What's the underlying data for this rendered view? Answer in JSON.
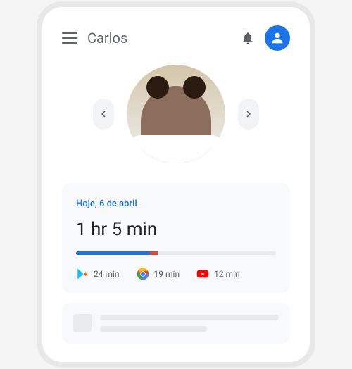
{
  "header": {
    "title": "Carlos"
  },
  "usage_card": {
    "date_label": "Hoje, 6 de abril",
    "total_time": "1 hr 5 min",
    "apps": [
      {
        "name": "play",
        "time": "24 min"
      },
      {
        "name": "chrome",
        "time": "19 min"
      },
      {
        "name": "youtube",
        "time": "12 min"
      }
    ]
  }
}
